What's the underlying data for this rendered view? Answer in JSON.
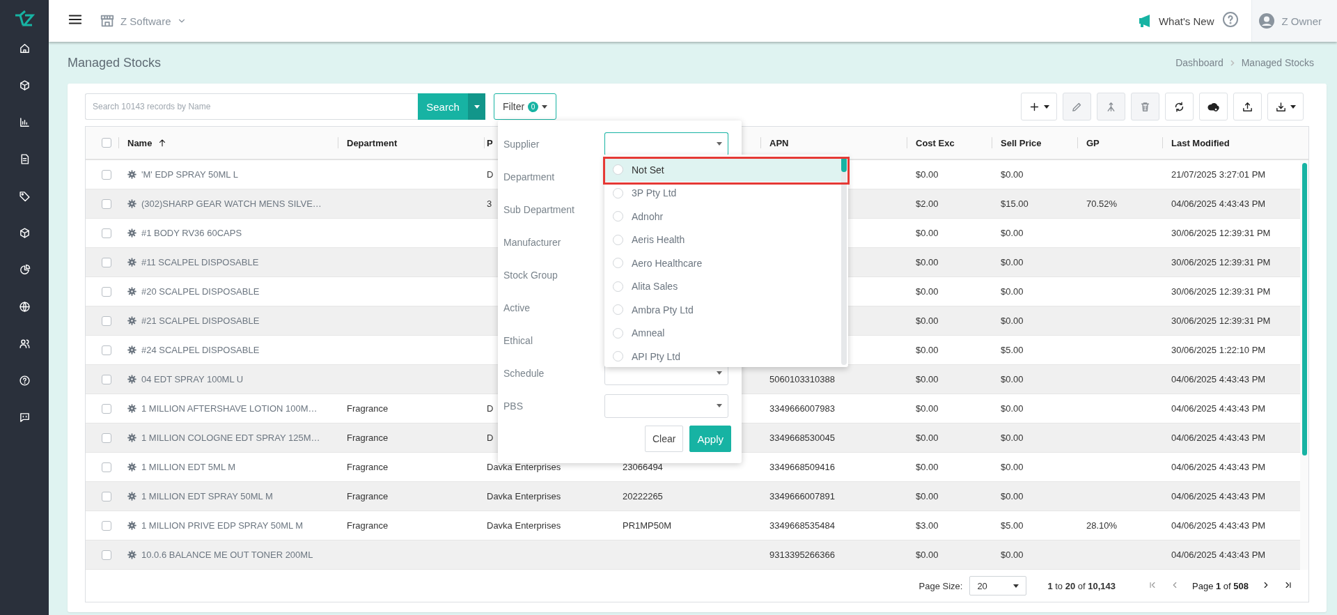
{
  "topbar": {
    "workspace": "Z Software",
    "whats_new": "What's New",
    "user": "Z Owner"
  },
  "page": {
    "title": "Managed Stocks",
    "breadcrumb": [
      "Dashboard",
      "Managed Stocks"
    ]
  },
  "search": {
    "placeholder": "Search 10143 records by Name",
    "button": "Search"
  },
  "filter": {
    "label": "Filter",
    "count": "0",
    "fields": [
      {
        "label": "Supplier",
        "expanded": true
      },
      {
        "label": "Department",
        "expanded": false
      },
      {
        "label": "Sub Department",
        "expanded": false
      },
      {
        "label": "Manufacturer",
        "expanded": false
      },
      {
        "label": "Stock Group",
        "expanded": false
      },
      {
        "label": "Active",
        "expanded": false
      },
      {
        "label": "Ethical",
        "expanded": false
      },
      {
        "label": "Schedule",
        "expanded": false
      },
      {
        "label": "PBS",
        "expanded": false
      }
    ],
    "options": [
      {
        "label": "Not Set",
        "selected": true,
        "outlined": true
      },
      {
        "label": "3P Pty Ltd",
        "selected": false,
        "outlined": false
      },
      {
        "label": "Adnohr",
        "selected": false,
        "outlined": false
      },
      {
        "label": "Aeris Health",
        "selected": false,
        "outlined": false
      },
      {
        "label": "Aero Healthcare",
        "selected": false,
        "outlined": false
      },
      {
        "label": "Alita Sales",
        "selected": false,
        "outlined": false
      },
      {
        "label": "Ambra Pty Ltd",
        "selected": false,
        "outlined": false
      },
      {
        "label": "Amneal",
        "selected": false,
        "outlined": false
      },
      {
        "label": "API Pty Ltd",
        "selected": false,
        "outlined": false
      }
    ],
    "buttons": [
      {
        "label": "Clear",
        "kind": "secondary"
      },
      {
        "label": "Apply",
        "kind": "primary"
      }
    ]
  },
  "toolbar": [
    {
      "kind": "add",
      "disabled": false,
      "menu": true
    },
    {
      "kind": "edit",
      "disabled": true,
      "menu": false
    },
    {
      "kind": "merge",
      "disabled": true,
      "menu": false
    },
    {
      "kind": "delete",
      "disabled": true,
      "menu": false
    },
    {
      "kind": "refresh",
      "disabled": false,
      "menu": false
    },
    {
      "kind": "cloud",
      "disabled": false,
      "menu": false
    },
    {
      "kind": "upload",
      "disabled": false,
      "menu": false
    },
    {
      "kind": "download",
      "disabled": false,
      "menu": true
    }
  ],
  "table": {
    "select_all_checked": false,
    "columns": [
      {
        "label": "Name",
        "sorted": true
      },
      {
        "label": "Department",
        "sorted": false
      },
      {
        "label": "P"
      },
      {},
      {
        "label": "APN",
        "sorted": false
      },
      {
        "label": "Cost Exc",
        "sorted": false
      },
      {
        "label": "Sell Price",
        "sorted": false
      },
      {
        "label": "GP",
        "sorted": false
      },
      {
        "label": "Last Modified",
        "sorted": false
      }
    ],
    "rows": [
      {
        "checked": false,
        "name": "'M' EDP SPRAY 50ML L",
        "column_3": "D",
        "cost_exc": "$0.00",
        "sell_price": "$0.00",
        "last_modified": "21/07/2025 3:27:01 PM"
      },
      {
        "checked": false,
        "name": "(302)SHARP GEAR WATCH MENS SILVE…",
        "column_3": "3",
        "cost_exc": "$2.00",
        "sell_price": "$15.00",
        "gp": "70.52%",
        "last_modified": "04/06/2025 4:43:43 PM"
      },
      {
        "checked": false,
        "name": "#1 BODY RV36 60CAPS",
        "cost_exc": "$0.00",
        "sell_price": "$0.00",
        "last_modified": "30/06/2025 12:39:31 PM"
      },
      {
        "checked": false,
        "name": "#11 SCALPEL DISPOSABLE",
        "cost_exc": "$0.00",
        "sell_price": "$0.00",
        "last_modified": "30/06/2025 12:39:31 PM"
      },
      {
        "checked": false,
        "name": "#20 SCALPEL DISPOSABLE",
        "cost_exc": "$0.00",
        "sell_price": "$0.00",
        "last_modified": "30/06/2025 12:39:31 PM"
      },
      {
        "checked": false,
        "name": "#21 SCALPEL DISPOSABLE",
        "cost_exc": "$0.00",
        "sell_price": "$0.00",
        "last_modified": "30/06/2025 12:39:31 PM"
      },
      {
        "checked": false,
        "name": "#24 SCALPEL DISPOSABLE",
        "cost_exc": "$0.00",
        "sell_price": "$5.00",
        "last_modified": "30/06/2025 1:22:10 PM"
      },
      {
        "checked": false,
        "name": "04 EDT SPRAY 100ML U",
        "apn": "5060103310388",
        "cost_exc": "$0.00",
        "sell_price": "$0.00",
        "last_modified": "04/06/2025 4:43:43 PM"
      },
      {
        "checked": false,
        "name": "1 MILLION AFTERSHAVE LOTION 100M…",
        "department": "Fragrance",
        "column_3": "D",
        "apn": "3349666007983",
        "cost_exc": "$0.00",
        "sell_price": "$0.00",
        "last_modified": "04/06/2025 4:43:43 PM"
      },
      {
        "checked": false,
        "name": "1 MILLION COLOGNE EDT SPRAY 125M…",
        "department": "Fragrance",
        "column_3": "D",
        "apn": "3349668530045",
        "cost_exc": "$0.00",
        "sell_price": "$0.00",
        "last_modified": "04/06/2025 4:43:43 PM"
      },
      {
        "checked": false,
        "name": "1 MILLION EDT 5ML M",
        "department": "Fragrance",
        "column_3": "Davka Enterprises",
        "column_4": "23066494",
        "apn": "3349668509416",
        "cost_exc": "$0.00",
        "sell_price": "$0.00",
        "last_modified": "04/06/2025 4:43:43 PM"
      },
      {
        "checked": false,
        "name": "1 MILLION EDT SPRAY 50ML M",
        "department": "Fragrance",
        "column_3": "Davka Enterprises",
        "column_4": "20222265",
        "apn": "3349666007891",
        "cost_exc": "$0.00",
        "sell_price": "$0.00",
        "last_modified": "04/06/2025 4:43:43 PM"
      },
      {
        "checked": false,
        "name": "1 MILLION PRIVE EDP SPRAY 50ML M",
        "department": "Fragrance",
        "column_3": "Davka Enterprises",
        "column_4": "PR1MP50M",
        "apn": "3349668535484",
        "cost_exc": "$3.00",
        "sell_price": "$5.00",
        "gp": "28.10%",
        "last_modified": "04/06/2025 4:43:43 PM"
      },
      {
        "checked": false,
        "name": "10.0.6 BALANCE ME OUT TONER 200ML",
        "apn": "9313395266366",
        "cost_exc": "$0.00",
        "sell_price": "$0.00",
        "last_modified": "04/06/2025 4:43:43 PM"
      }
    ]
  },
  "footer": {
    "page_size_label": "Page Size:",
    "page_size": "20",
    "range": "**1** to **20** of **10,143**",
    "page": "Page **1** of **508**",
    "pager": [
      {
        "kind": "first",
        "disabled": true
      },
      {
        "kind": "prev",
        "disabled": true
      },
      {
        "kind": "next",
        "disabled": false
      },
      {
        "kind": "last",
        "disabled": false
      }
    ]
  }
}
